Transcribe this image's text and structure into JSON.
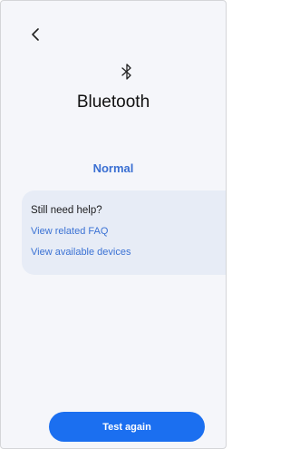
{
  "header": {
    "back_icon": "chevron-left-icon",
    "title": "Bluetooth",
    "title_icon": "bluetooth-icon"
  },
  "status": {
    "label": "Normal",
    "color": "#3a6fd2"
  },
  "help_card": {
    "title": "Still need help?",
    "links": [
      {
        "label": "View related FAQ"
      },
      {
        "label": "View available devices"
      }
    ],
    "background": "#e7ecf6",
    "link_color": "#3b72d4"
  },
  "actions": {
    "test_again_label": "Test again",
    "button_color": "#1b6ff0"
  }
}
